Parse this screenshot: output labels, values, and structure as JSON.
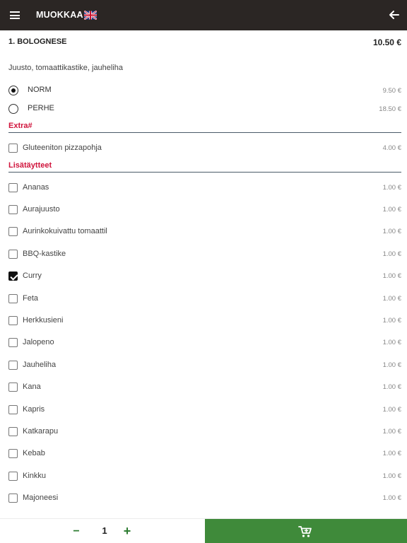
{
  "header": {
    "title": "MUOKKAA",
    "language_icon": "uk-flag-icon",
    "menu_icon": "hamburger-icon",
    "back_icon": "arrow-left-icon",
    "background_color": "#2b2624"
  },
  "product": {
    "name": "1. BOLOGNESE",
    "price": "10.50 €",
    "description": "Juusto, tomaattikastike, jauheliha"
  },
  "sizes": [
    {
      "label": "NORM",
      "price": "9.50 €",
      "selected": true
    },
    {
      "label": "PERHE",
      "price": "18.50 €",
      "selected": false
    }
  ],
  "sections": {
    "extra": {
      "title": "Extra#",
      "items": [
        {
          "label": "Gluteeniton pizzapohja",
          "price": "4.00 €",
          "checked": false
        }
      ]
    },
    "toppings": {
      "title": "Lisätäytteet",
      "items": [
        {
          "label": "Ananas",
          "price": "1.00 €",
          "checked": false
        },
        {
          "label": "Aurajuusto",
          "price": "1.00 €",
          "checked": false
        },
        {
          "label": "Aurinkokuivattu tomaattil",
          "price": "1.00 €",
          "checked": false
        },
        {
          "label": "BBQ-kastike",
          "price": "1.00 €",
          "checked": false
        },
        {
          "label": "Curry",
          "price": "1.00 €",
          "checked": true
        },
        {
          "label": "Feta",
          "price": "1.00 €",
          "checked": false
        },
        {
          "label": "Herkkusieni",
          "price": "1.00 €",
          "checked": false
        },
        {
          "label": "Jalopeno",
          "price": "1.00 €",
          "checked": false
        },
        {
          "label": "Jauheliha",
          "price": "1.00 €",
          "checked": false
        },
        {
          "label": "Kana",
          "price": "1.00 €",
          "checked": false
        },
        {
          "label": "Kapris",
          "price": "1.00 €",
          "checked": false
        },
        {
          "label": "Katkarapu",
          "price": "1.00 €",
          "checked": false
        },
        {
          "label": "Kebab",
          "price": "1.00 €",
          "checked": false
        },
        {
          "label": "Kinkku",
          "price": "1.00 €",
          "checked": false
        },
        {
          "label": "Majoneesi",
          "price": "1.00 €",
          "checked": false
        }
      ]
    }
  },
  "footer": {
    "minus_label": "−",
    "quantity": "1",
    "plus_label": "+",
    "cart_icon": "cart-add-icon",
    "cart_button_color": "#3f8a3a"
  }
}
